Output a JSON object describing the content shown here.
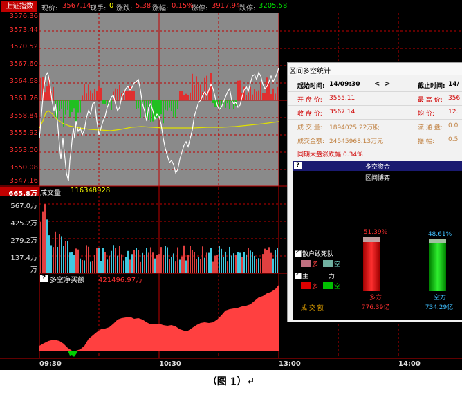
{
  "header": {
    "index_name": "上证指数",
    "fields": [
      {
        "label": "现价:",
        "value": "3567.14"
      },
      {
        "label": "现手:",
        "value": "0"
      },
      {
        "label": "涨跌:",
        "value": "5.38"
      },
      {
        "label": "涨幅:",
        "value": "0.15%"
      },
      {
        "label": "涨停:",
        "value": "3917.94"
      },
      {
        "label": "跌停:",
        "value": "3205.58"
      }
    ]
  },
  "price_axis": [
    "3576.36",
    "3573.44",
    "3570.52",
    "3567.60",
    "3564.68",
    "3561.76",
    "3558.84",
    "3555.92",
    "3553.00",
    "3550.08",
    "3547.16"
  ],
  "volume_panel": {
    "title": "成交量",
    "total": "116348928",
    "axis": [
      "665.8万",
      "567.0万",
      "425.2万",
      "279.2万",
      "137.4万",
      "万"
    ]
  },
  "net_panel": {
    "question": "?",
    "title": "多空净买额",
    "value": "421496.97万"
  },
  "time_axis": [
    "09:30",
    "10:30",
    "13:00",
    "14:00"
  ],
  "stats_window": {
    "title": "区间多空统计",
    "start_label": "起始时间:",
    "start_value": "14/09:30",
    "prev_arrow": "<",
    "next_arrow": ">",
    "end_label": "截止时间:",
    "end_value": "14/",
    "open_label": "开 盘 价:",
    "open_value": "3555.11",
    "high_label": "最 高 价:",
    "high_value": "356",
    "close_label": "收 盘 价:",
    "close_value": "3567.14",
    "avg_label": "均    价:",
    "avg_value": "12.",
    "vol_label": "成 交 量:",
    "vol_value": "1894025.22万股",
    "float_label": "流 通 盘:",
    "float_value": "0.0",
    "amount_label": "成交金额:",
    "amount_value": "24545968.13万元",
    "swing_label": "振    幅:",
    "swing_value": "0.5",
    "same_period": "同期大盘涨跌幅:0.34%"
  },
  "fund_window": {
    "question": "?",
    "title": "多空资金",
    "subtitle": "区间博弈",
    "retail_label": "散户敢死队",
    "retail_long": "多",
    "retail_short": "空",
    "main_label": "主",
    "main_label2": "力",
    "main_long": "多",
    "main_short": "空",
    "amount_caption": "成  交  额",
    "long_pct": "51.39%",
    "long_name": "多方",
    "long_amount": "776.39亿",
    "short_pct": "48.61%",
    "short_name": "空方",
    "short_amount": "734.29亿",
    "long_pct_value": 51.39,
    "short_pct_value": 48.61
  },
  "caption": "（图 1）↵"
}
